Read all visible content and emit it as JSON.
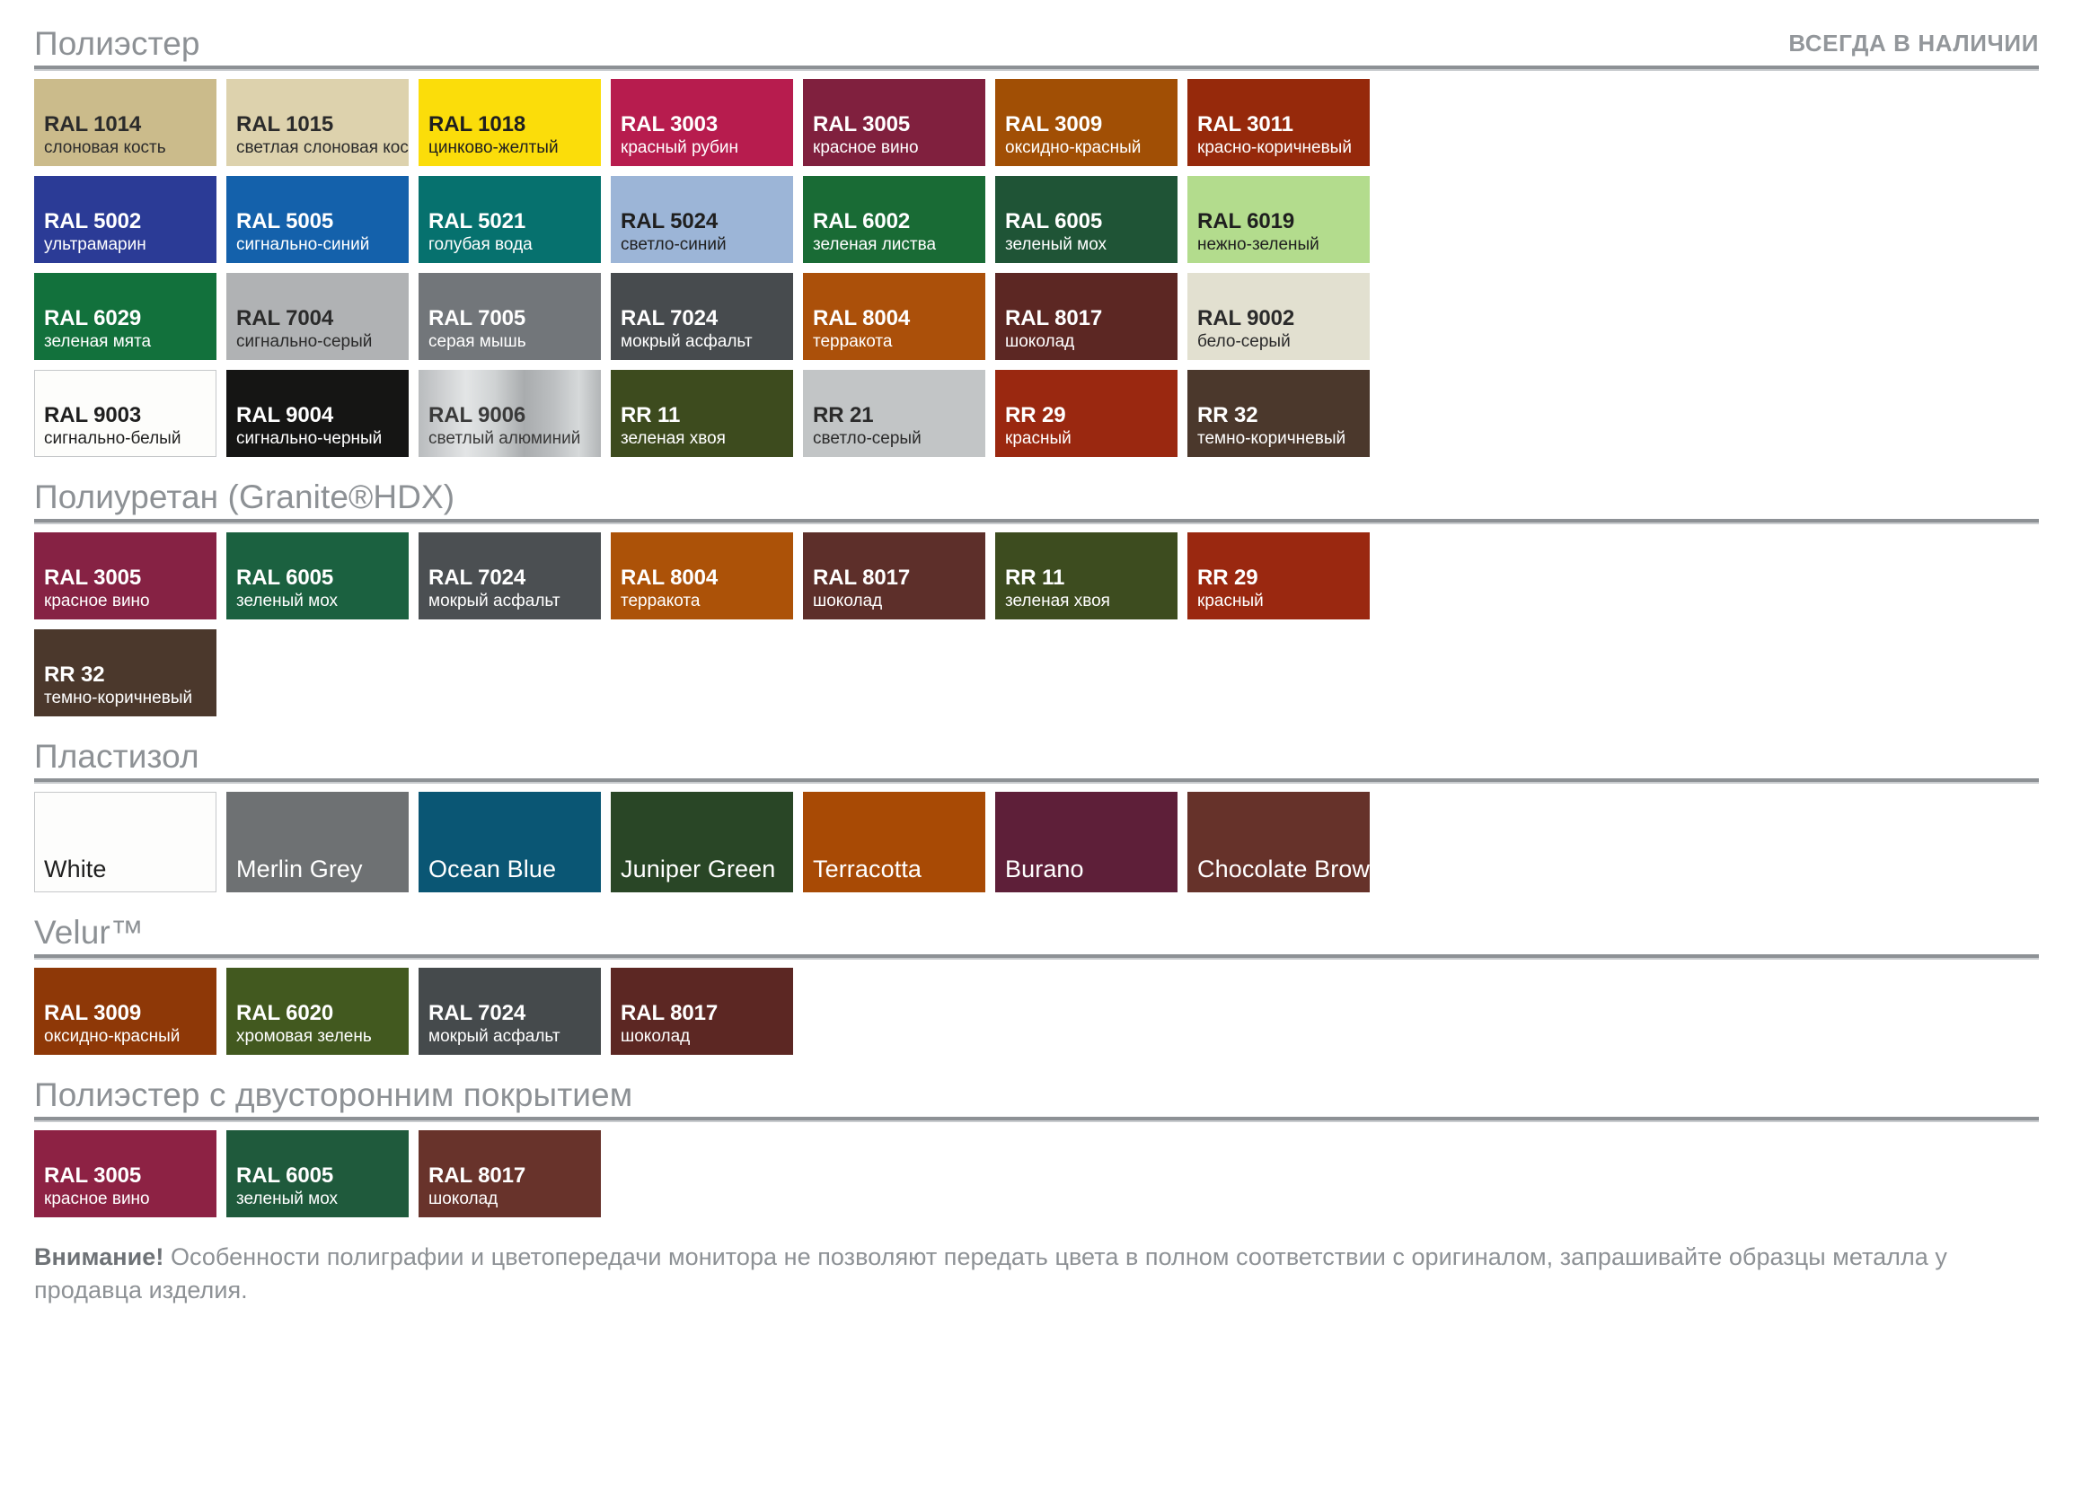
{
  "header": {
    "availability": "ВСЕГДА В НАЛИЧИИ"
  },
  "sections": [
    {
      "id": "polyester",
      "title": "Полиэстер",
      "has_availability": true,
      "label_style": "code-name",
      "swatches": [
        {
          "code": "RAL 1014",
          "name": "слоновая кость",
          "bg": "#cbbb8b",
          "fg": "#2b2b2b"
        },
        {
          "code": "RAL 1015",
          "name": "светлая слоновая кость",
          "bg": "#ddd2ad",
          "fg": "#2b2b2b"
        },
        {
          "code": "RAL 1018",
          "name": "цинково-желтый",
          "bg": "#fbdd0a",
          "fg": "#1f1f1f"
        },
        {
          "code": "RAL 3003",
          "name": "красный рубин",
          "bg": "#b71c4e",
          "fg": "#ffffff"
        },
        {
          "code": "RAL 3005",
          "name": "красное вино",
          "bg": "#80203e",
          "fg": "#ffffff"
        },
        {
          "code": "RAL 3009",
          "name": "оксидно-красный",
          "bg": "#a14f05",
          "fg": "#ffffff"
        },
        {
          "code": "RAL 3011",
          "name": "красно-коричневый",
          "bg": "#96290b",
          "fg": "#ffffff"
        },
        {
          "code": "RAL 5002",
          "name": "ультрамарин",
          "bg": "#2b3b96",
          "fg": "#ffffff"
        },
        {
          "code": "RAL 5005",
          "name": "сигнально-синий",
          "bg": "#1461ab",
          "fg": "#ffffff"
        },
        {
          "code": "RAL 5021",
          "name": "голубая вода",
          "bg": "#06716e",
          "fg": "#ffffff"
        },
        {
          "code": "RAL 5024",
          "name": "светло-синий",
          "bg": "#9cb5d7",
          "fg": "#1f1f1f"
        },
        {
          "code": "RAL 6002",
          "name": "зеленая листва",
          "bg": "#196b35",
          "fg": "#ffffff"
        },
        {
          "code": "RAL 6005",
          "name": "зеленый мох",
          "bg": "#1f5436",
          "fg": "#ffffff"
        },
        {
          "code": "RAL 6019",
          "name": "нежно-зеленый",
          "bg": "#b3dc8d",
          "fg": "#1f1f1f"
        },
        {
          "code": "RAL 6029",
          "name": "зеленая мята",
          "bg": "#12713c",
          "fg": "#ffffff"
        },
        {
          "code": "RAL 7004",
          "name": "сигнально-серый",
          "bg": "#b0b2b4",
          "fg": "#2b2b2b"
        },
        {
          "code": "RAL 7005",
          "name": "серая мышь",
          "bg": "#72767a",
          "fg": "#ffffff"
        },
        {
          "code": "RAL 7024",
          "name": "мокрый асфальт",
          "bg": "#474b4e",
          "fg": "#ffffff"
        },
        {
          "code": "RAL 8004",
          "name": "терракота",
          "bg": "#ab500a",
          "fg": "#ffffff"
        },
        {
          "code": "RAL 8017",
          "name": "шоколад",
          "bg": "#5c2723",
          "fg": "#ffffff"
        },
        {
          "code": "RAL 9002",
          "name": "бело-серый",
          "bg": "#e2e0d0",
          "fg": "#2b2b2b"
        },
        {
          "code": "RAL 9003",
          "name": "сигнально-белый",
          "bg": "#fdfdfb",
          "fg": "#1f1f1f",
          "bordered": true
        },
        {
          "code": "RAL 9004",
          "name": "сигнально-черный",
          "bg": "#151514",
          "fg": "#ffffff"
        },
        {
          "code": "RAL 9006",
          "name": "светлый алюминий",
          "bg": "metallic",
          "fg": "#3a3a3a"
        },
        {
          "code": "RR 11",
          "name": "зеленая хвоя",
          "bg": "#3d4b1e",
          "fg": "#ffffff"
        },
        {
          "code": "RR 21",
          "name": "светло-серый",
          "bg": "#c2c5c6",
          "fg": "#2b2b2b"
        },
        {
          "code": "RR 29",
          "name": "красный",
          "bg": "#9a2810",
          "fg": "#ffffff"
        },
        {
          "code": "RR 32",
          "name": "темно-коричневый",
          "bg": "#4b382c",
          "fg": "#ffffff"
        }
      ]
    },
    {
      "id": "polyurethane",
      "title": "Полиуретан (Granite®HDX)",
      "has_availability": false,
      "label_style": "code-name",
      "swatches": [
        {
          "code": "RAL 3005",
          "name": "красное вино",
          "bg": "#862244",
          "fg": "#ffffff"
        },
        {
          "code": "RAL 6005",
          "name": "зеленый мох",
          "bg": "#1b6140",
          "fg": "#ffffff"
        },
        {
          "code": "RAL 7024",
          "name": "мокрый асфальт",
          "bg": "#4b4f52",
          "fg": "#ffffff"
        },
        {
          "code": "RAL 8004",
          "name": "терракота",
          "bg": "#ac5208",
          "fg": "#ffffff"
        },
        {
          "code": "RAL 8017",
          "name": "шоколад",
          "bg": "#5d2f2a",
          "fg": "#ffffff"
        },
        {
          "code": "RR 11",
          "name": "зеленая хвоя",
          "bg": "#3d4c1f",
          "fg": "#ffffff"
        },
        {
          "code": "RR 29",
          "name": "красный",
          "bg": "#9a2810",
          "fg": "#ffffff"
        },
        {
          "code": "RR 32",
          "name": "темно-коричневый",
          "bg": "#4b382c",
          "fg": "#ffffff"
        }
      ]
    },
    {
      "id": "plastisol",
      "title": "Пластизол",
      "has_availability": false,
      "label_style": "name-only",
      "swatches": [
        {
          "code": "White",
          "name": "",
          "bg": "#fdfdfc",
          "fg": "#1f1f1f",
          "bordered": true
        },
        {
          "code": "Merlin Grey",
          "name": "",
          "bg": "#6e7173",
          "fg": "#ffffff"
        },
        {
          "code": "Ocean Blue",
          "name": "",
          "bg": "#0a5674",
          "fg": "#ffffff"
        },
        {
          "code": "Juniper Green",
          "name": "",
          "bg": "#294626",
          "fg": "#ffffff"
        },
        {
          "code": "Terracotta",
          "name": "",
          "bg": "#a84a05",
          "fg": "#ffffff"
        },
        {
          "code": "Burano",
          "name": "",
          "bg": "#5e1f39",
          "fg": "#ffffff"
        },
        {
          "code": "Chocolate Brown",
          "name": "",
          "bg": "#66322a",
          "fg": "#ffffff"
        }
      ]
    },
    {
      "id": "velur",
      "title": "Velur™",
      "has_availability": false,
      "label_style": "code-name",
      "swatches": [
        {
          "code": "RAL 3009",
          "name": "оксидно-красный",
          "bg": "#8e3807",
          "fg": "#ffffff"
        },
        {
          "code": "RAL 6020",
          "name": "хромовая зелень",
          "bg": "#42591f",
          "fg": "#ffffff"
        },
        {
          "code": "RAL 7024",
          "name": "мокрый асфальт",
          "bg": "#454a4c",
          "fg": "#ffffff"
        },
        {
          "code": "RAL 8017",
          "name": "шоколад",
          "bg": "#5c2723",
          "fg": "#ffffff"
        }
      ]
    },
    {
      "id": "polyester-double",
      "title": "Полиэстер с двусторонним покрытием",
      "has_availability": false,
      "label_style": "code-name",
      "swatches": [
        {
          "code": "RAL 3005",
          "name": "красное вино",
          "bg": "#8d2244",
          "fg": "#ffffff"
        },
        {
          "code": "RAL 6005",
          "name": "зеленый мох",
          "bg": "#1f5a3c",
          "fg": "#ffffff"
        },
        {
          "code": "RAL 8017",
          "name": "шоколад",
          "bg": "#68332b",
          "fg": "#ffffff"
        }
      ]
    }
  ],
  "footer": {
    "warning_label": "Внимание!",
    "warning_text": " Особенности полиграфии и цветопередачи монитора не позволяют передать цвета в полном соответствии с оригиналом, запрашивайте образцы металла у продавца изделия."
  },
  "colors": {
    "rule": "#8d9195",
    "rule_shadow": "#c9cccf",
    "heading": "#8d9195",
    "note": "#8d9195",
    "page_bg": "#ffffff"
  }
}
